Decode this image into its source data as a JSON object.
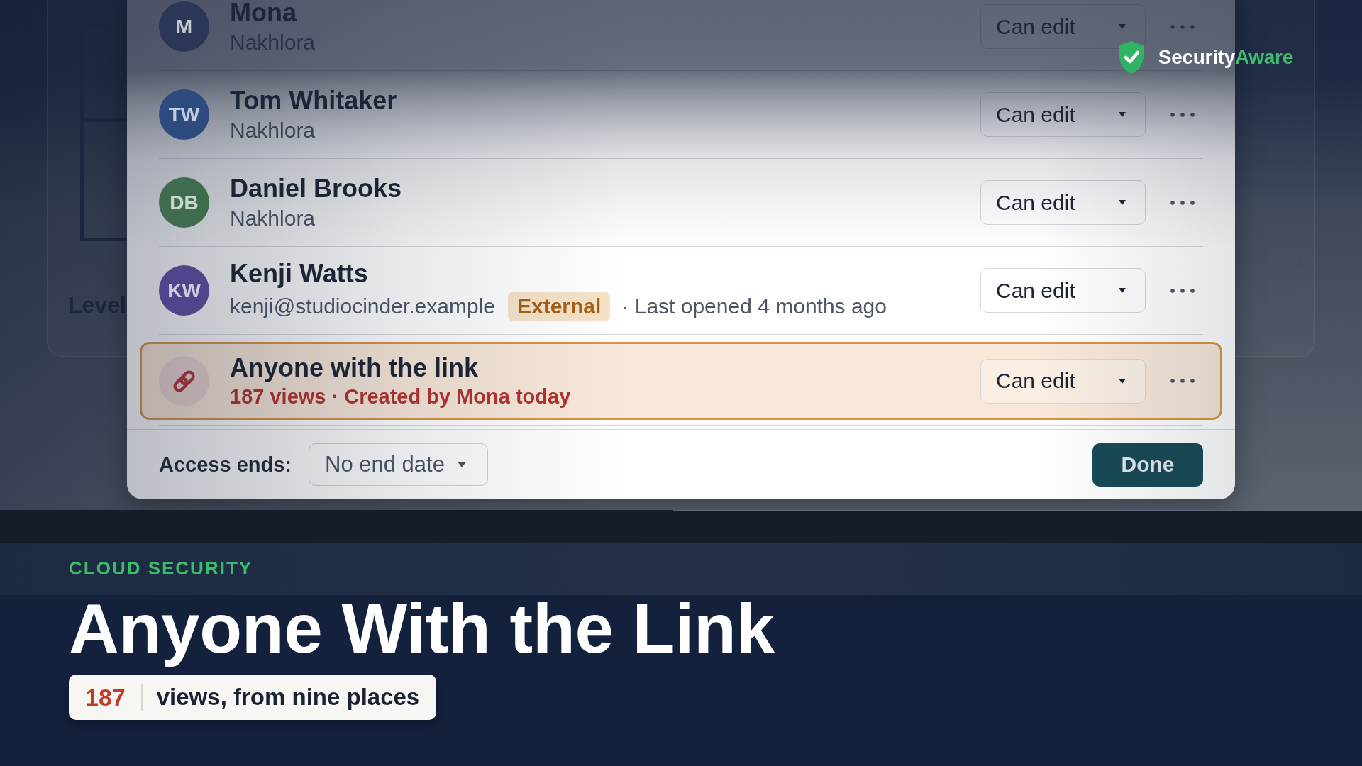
{
  "background_app": {
    "label": "Level"
  },
  "brand": {
    "name": "Security",
    "accent": "Aware"
  },
  "share_dialog": {
    "members": [
      {
        "initials": "M",
        "name": "Mona",
        "detail": "Nakhlora",
        "color": "#2b3756",
        "permission": "Can edit"
      },
      {
        "initials": "TW",
        "name": "Tom Whitaker",
        "detail": "Nakhlora",
        "color": "#2d4b7e",
        "permission": "Can edit"
      },
      {
        "initials": "DB",
        "name": "Daniel Brooks",
        "detail": "Nakhlora",
        "color": "#3f6c4f",
        "permission": "Can edit"
      },
      {
        "initials": "KW",
        "name": "Kenji Watts",
        "detail": "kenji@studiocinder.example",
        "tag": "External",
        "note": "· Last opened 4 months ago",
        "color": "#4f458a",
        "permission": "Can edit"
      }
    ],
    "link_access": {
      "title": "Anyone with the link",
      "detail": "187 views · Created by Mona today",
      "permission": "Can edit",
      "highlighted": true
    },
    "footer": {
      "label": "Access ends:",
      "end_date": "No end date",
      "button": "Done"
    }
  },
  "lower_third": {
    "kicker": "CLOUD SECURITY",
    "headline": "Anyone With the Link",
    "stat": {
      "value": "187",
      "text": "views, from nine places"
    }
  }
}
